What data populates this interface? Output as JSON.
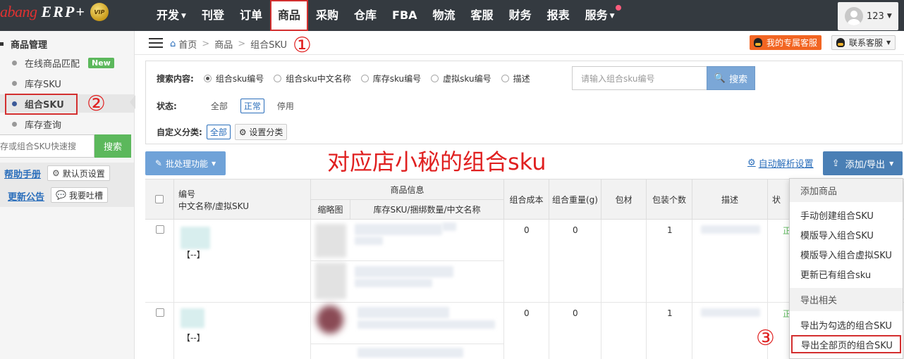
{
  "logo": {
    "brand": "abang",
    "erp": "ERP+",
    "vip": "VIP"
  },
  "nav": {
    "items": [
      {
        "label": "开发",
        "caret": true
      },
      {
        "label": "刊登"
      },
      {
        "label": "订单"
      },
      {
        "label": "商品",
        "active": true
      },
      {
        "label": "采购"
      },
      {
        "label": "仓库"
      },
      {
        "label": "FBA"
      },
      {
        "label": "物流"
      },
      {
        "label": "客服"
      },
      {
        "label": "财务"
      },
      {
        "label": "报表"
      },
      {
        "label": "服务",
        "caret": true,
        "dot": true
      }
    ],
    "user": "123"
  },
  "sidebar": {
    "title": "商品管理",
    "items": [
      {
        "label": "在线商品匹配",
        "tag": "New"
      },
      {
        "label": "库存SKU"
      },
      {
        "label": "组合SKU",
        "active": true
      },
      {
        "label": "库存查询"
      }
    ],
    "search_placeholder": "存或组合SKU快速搜",
    "search_button": "搜索",
    "help_link": "帮助手册",
    "default_page_btn": "默认页设置",
    "news_link": "更新公告",
    "feedback_btn": "我要吐槽"
  },
  "breadcrumb": {
    "home": "首页",
    "level1": "商品",
    "level2": "组合SKU"
  },
  "service": {
    "exclusive": "我的专属客服",
    "contact": "联系客服"
  },
  "search": {
    "label": "搜索内容:",
    "options": [
      "组合sku编号",
      "组合sku中文名称",
      "库存sku编号",
      "虚拟sku编号",
      "描述"
    ],
    "placeholder": "请输入组合sku编号",
    "button": "搜索",
    "status_label": "状态:",
    "status_options": [
      "全部",
      "正常",
      "停用"
    ],
    "category_label": "自定义分类:",
    "category_all": "全部",
    "category_setting": "设置分类"
  },
  "toolbar": {
    "batch": "批处理功能",
    "overlay_text": "对应店小秘的组合sku",
    "auto_parse": "自动解析设置",
    "add_export": "添加/导出"
  },
  "table": {
    "headers": {
      "code": "编号",
      "code_sub": "中文名称/虚拟SKU",
      "product_info": "商品信息",
      "thumbnail": "缩略图",
      "stock_info": "库存SKU/捆绑数量/中文名称",
      "cost": "组合成本",
      "weight": "组合重量(g)",
      "material": "包材",
      "pack_count": "包装个数",
      "desc": "描述",
      "status": "状"
    },
    "rows": [
      {
        "tag": "【--】",
        "cost": "0",
        "weight": "0",
        "pack": "1",
        "status": "正"
      },
      {
        "tag": "【--】",
        "cost": "0",
        "weight": "0",
        "pack": "1",
        "status": "正"
      }
    ]
  },
  "dropdown": {
    "section1": "添加商品",
    "items1": [
      "手动创建组合SKU",
      "模版导入组合SKU",
      "模版导入组合虚拟SKU",
      "更新已有组合sku"
    ],
    "section2": "导出相关",
    "items2": [
      "导出为勾选的组合SKU",
      "导出全部页的组合SKU"
    ]
  },
  "annotations": {
    "one": "①",
    "two": "②",
    "three": "③"
  }
}
